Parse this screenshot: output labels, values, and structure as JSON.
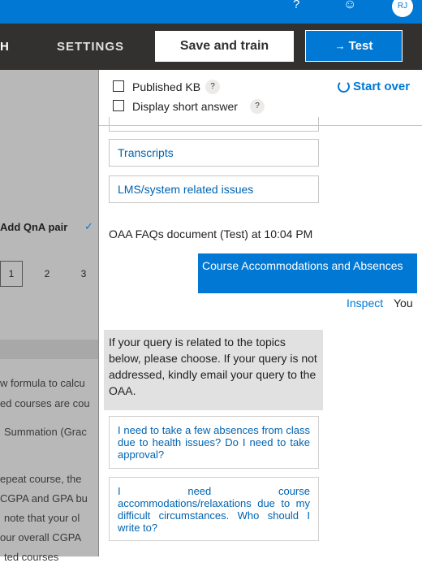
{
  "header": {
    "help_icon": "?",
    "feedback_icon": "☺",
    "avatar_initials": "RJ",
    "accent_color": "#0078d4"
  },
  "nav": {
    "partial_tab": "H",
    "settings_label": "SETTINGS",
    "save_label": "Save and train",
    "test_arrow": "→",
    "test_label": "Test"
  },
  "editor": {
    "add_qna_label": "Add QnA pair",
    "check_icon": "✓",
    "pages": [
      "1",
      "2",
      "3"
    ],
    "lines": [
      "w formula to calcu",
      "ed courses are cou",
      "Summation (Grac",
      "epeat course, the",
      "CGPA and GPA bu",
      "note that your ol",
      "our overall CGPA",
      "ted courses"
    ]
  },
  "panel": {
    "published_kb_label": "Published KB",
    "display_short_label": "Display short answer",
    "q_icon": "?",
    "start_over_label": "Start over",
    "prompts": [
      "Transcripts",
      "LMS/system related issues"
    ],
    "meta": "OAA FAQs document (Test) at 10:04 PM",
    "user_message": "Course Accommodations and Absences",
    "inspect_label": "Inspect",
    "you_label": "You",
    "bot_message": "If your query is related to the topics below, please choose. If your query is not addressed, kindly email your query to the OAA.",
    "options": [
      "I need to take a few absences from class due to health issues? Do I need to take approval?",
      "I need course accommodations/relaxations due to my difficult circumstances. Who should I write to?"
    ]
  }
}
